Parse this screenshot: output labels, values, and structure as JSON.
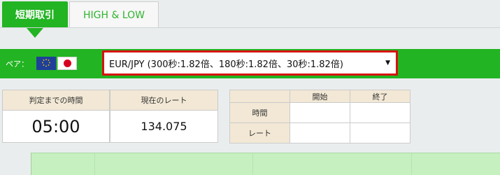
{
  "tabs": {
    "short_term": "短期取引",
    "high_low": "HIGH & LOW"
  },
  "pair": {
    "label": "ペア：",
    "flags": [
      "eu-flag-icon",
      "japan-flag-icon"
    ],
    "selected": "EUR/JPY (300秒:1.82倍、180秒:1.82倍、30秒:1.82倍)",
    "arrow": "▼"
  },
  "info": {
    "time_to_judge_label": "判定までの時間",
    "time_to_judge_value": "05:00",
    "current_rate_label": "現在のレート",
    "current_rate_value": "134.075"
  },
  "table": {
    "start_header": "開始",
    "end_header": "終了",
    "rows": [
      {
        "label": "時間",
        "start": "",
        "end": ""
      },
      {
        "label": "レート",
        "start": "",
        "end": ""
      }
    ]
  },
  "colors": {
    "brand_green": "#22b422",
    "highlight_red": "#d71111",
    "header_beige": "#f2e8d5",
    "chart_bg": "#c6f0c0"
  }
}
